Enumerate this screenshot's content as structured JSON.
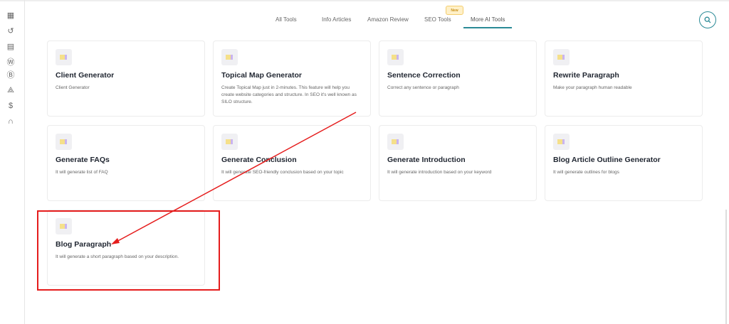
{
  "sidebar": {
    "icons": [
      "dashboard-icon",
      "history-icon",
      "document-icon",
      "wordpress-icon",
      "blogger-icon",
      "webhook-icon",
      "dollar-icon",
      "headset-icon"
    ]
  },
  "tabs": [
    {
      "label": "All Tools"
    },
    {
      "label": "Info Articles"
    },
    {
      "label": "Amazon Review"
    },
    {
      "label": "SEO Tools",
      "badge": "New"
    },
    {
      "label": "More AI Tools",
      "active": true
    }
  ],
  "accent": "#2a8a96",
  "cards": [
    {
      "title": "Client Generator",
      "desc": "Client Generator"
    },
    {
      "title": "Topical Map Generator",
      "desc": "Create Topical Map just in 2-minutes. This feature will help you create website categories and structure. In SEO it's well known as SILO structure."
    },
    {
      "title": "Sentence Correction",
      "desc": "Correct any sentence or paragraph"
    },
    {
      "title": "Rewrite Paragraph",
      "desc": "Make your paragraph human readable"
    },
    {
      "title": "Generate FAQs",
      "desc": "It will generate list of FAQ"
    },
    {
      "title": "Generate Conclusion",
      "desc": "It will generate SEO-friendly conclusion based on your topic"
    },
    {
      "title": "Generate Introduction",
      "desc": "It will generate introduction based on your keyword"
    },
    {
      "title": "Blog Article Outline Generator",
      "desc": "It will generate outlines for blogs"
    },
    {
      "title": "Blog Paragraph",
      "desc": "It will generate a short paragraph based on your description."
    }
  ],
  "annotation_color": "#e51c1c"
}
